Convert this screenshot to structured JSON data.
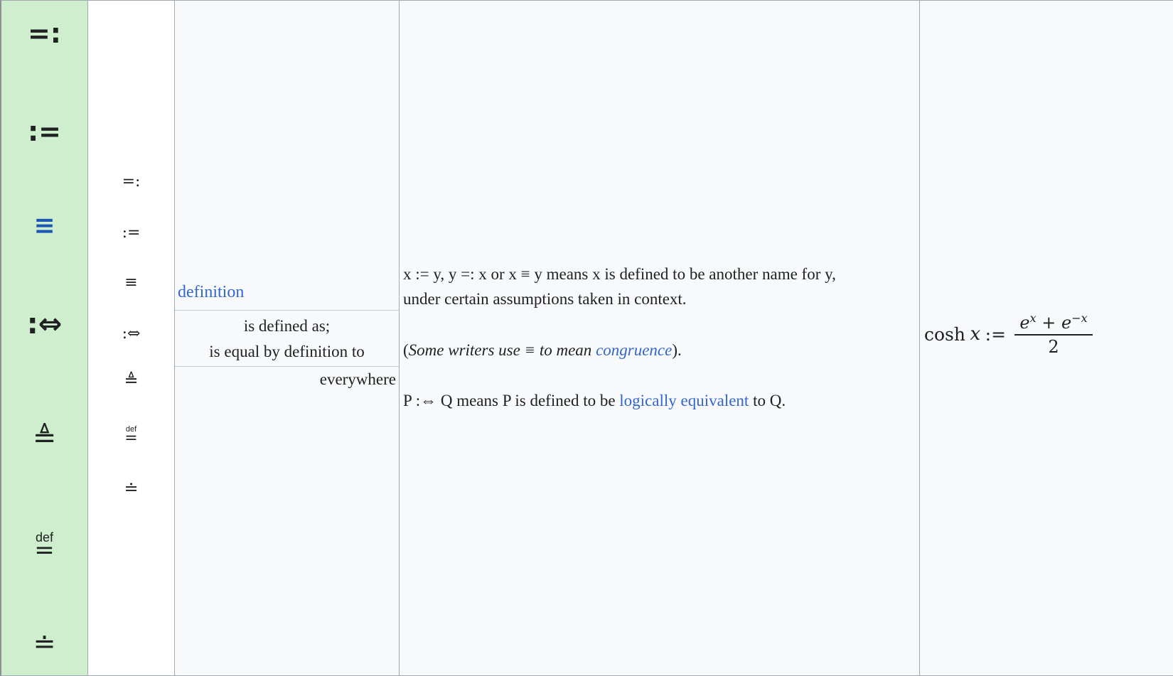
{
  "symbols_primary": [
    {
      "glyph": "=:"
    },
    {
      "glyph": ":="
    },
    {
      "glyph": "≡"
    },
    {
      "glyph": ":⇔"
    },
    {
      "glyph": "≜"
    },
    {
      "glyph_top": "def",
      "glyph_bar": "="
    },
    {
      "glyph": "≐"
    }
  ],
  "symbols_variants": [
    {
      "glyph": "=:"
    },
    {
      "glyph": ":="
    },
    {
      "glyph": "≡"
    },
    {
      "glyph": ":⇔"
    },
    {
      "glyph": "≜"
    },
    {
      "glyph_top": "def",
      "glyph_bar": "="
    },
    {
      "glyph": "≐"
    }
  ],
  "names": {
    "link": "definition",
    "category_line1": "is defined as;",
    "category_line2": "is equal by definition to",
    "scope": "everywhere"
  },
  "description": {
    "line1": "x := y, y =: x or x ≡ y means x is defined to be another name for y,",
    "line2": "under certain assumptions taken in context.",
    "note_prefix": "(",
    "note_italic": "Some writers use ≡ to mean ",
    "note_link": "congruence",
    "note_suffix": ").",
    "logic_prefix": "P :⇔ Q means P is defined to be ",
    "logic_link": "logically equivalent",
    "logic_suffix": " to Q."
  },
  "example": {
    "lhs": "cosh",
    "var": "x",
    "op": ":=",
    "numerator_base1": "e",
    "numerator_exp1": "x",
    "numerator_plus": " + ",
    "numerator_base2": "e",
    "numerator_exp2": "−x",
    "denominator": "2"
  },
  "colors": {
    "symbol_column_bg": "#cfeece",
    "link": "#3366cc",
    "highlight_symbol": "#1e56b3"
  }
}
